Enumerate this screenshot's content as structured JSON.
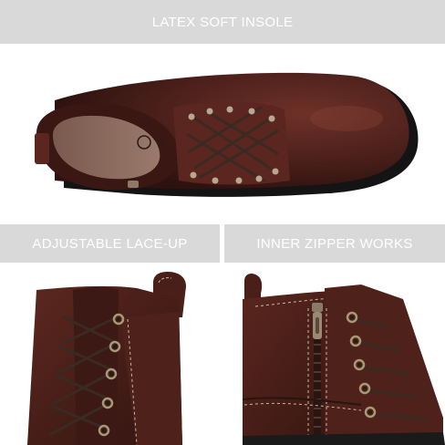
{
  "banners": {
    "top": "LATEX SOFT INSOLE",
    "left": "ADJUSTABLE LACE-UP",
    "right": "INNER ZIPPER WORKS"
  },
  "colors": {
    "banner_bg": "#d9d9d9",
    "banner_text": "#ffffff",
    "leather": "#4a1f1a",
    "leather_highlight": "#7a3a30",
    "sole": "#1a1a1a",
    "insole": "#8a6a5c",
    "lace": "#3a2a22",
    "eyelet": "#b8a890"
  },
  "images": {
    "top": "boot-top-view-insole",
    "left": "boot-lace-closeup",
    "right": "boot-zipper-side-closeup"
  }
}
